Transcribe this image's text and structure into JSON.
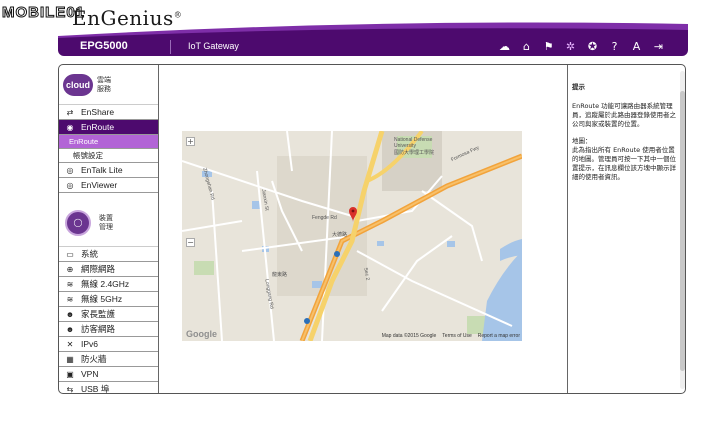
{
  "watermark": "MOBILE01",
  "logo": {
    "text": "EnGenius"
  },
  "header": {
    "device": "EPG5000",
    "mode": "IoT Gateway",
    "icons": [
      {
        "name": "cloud-download-icon",
        "glyph": "☁"
      },
      {
        "name": "home-icon",
        "glyph": "⌂"
      },
      {
        "name": "network-icon",
        "glyph": "⚑"
      },
      {
        "name": "settings-gear-icon",
        "glyph": "✲"
      },
      {
        "name": "wizard-icon",
        "glyph": "✪"
      },
      {
        "name": "help-icon",
        "glyph": "?"
      },
      {
        "name": "language-icon",
        "glyph": "A"
      },
      {
        "name": "logout-icon",
        "glyph": "⇥"
      }
    ]
  },
  "sidebar": {
    "cloud_badge": "cloud",
    "cloud_title": "雲端服務",
    "cloud_items": [
      {
        "label": "EnShare",
        "icon": "⇄"
      },
      {
        "label": "EnRoute",
        "icon": "◉"
      }
    ],
    "enroute_sub": "EnRoute",
    "enroute_sub2": "帳號設定",
    "cloud_items2": [
      {
        "label": "EnTalk Lite",
        "icon": "◎"
      },
      {
        "label": "EnViewer",
        "icon": "◎"
      }
    ],
    "mgmt_title": "裝置管理",
    "mgmt_items": [
      {
        "label": "系統",
        "icon": "▭"
      },
      {
        "label": "網際網路",
        "icon": "⊕"
      },
      {
        "label": "無線 2.4GHz",
        "icon": "≋"
      },
      {
        "label": "無線 5GHz",
        "icon": "≋"
      },
      {
        "label": "家長監護",
        "icon": "☻"
      },
      {
        "label": "訪客網路",
        "icon": "☻"
      },
      {
        "label": "IPv6",
        "icon": "✕"
      },
      {
        "label": "防火牆",
        "icon": "▦"
      },
      {
        "label": "VPN",
        "icon": "▣"
      },
      {
        "label": "USB 埠",
        "icon": "⇆"
      }
    ]
  },
  "map": {
    "labels": {
      "ndu": "National Defense University",
      "ndu_cn": "國防大學理工學院",
      "fengde": "Fengde Rd",
      "zhongshan": "Zhongshan Rd",
      "formosa": "Formosa Fwy",
      "jianxin": "Jianxin St",
      "longgang": "Longgang Rd",
      "sec2": "Sec 2",
      "dade": "大德路",
      "longdong": "龍東路"
    },
    "google": "Google",
    "footer": [
      "Map data ©2015 Google",
      "Terms of Use",
      "Report a map error"
    ],
    "zoom_in": "+",
    "zoom_out": "−"
  },
  "help": {
    "title": "提示",
    "p1": "EnRoute 功能可讓路由器系統管理員，追蹤屬於此路由器登錄使用者之公司與家或裝置的位置。",
    "sub": "地圖：",
    "p2": "此為指出所有 EnRoute 使用者位置的地圖。管理員可按一下其中一個位置提示，在訊息欄位該方塊中顯示詳細的使用者資訊。"
  }
}
